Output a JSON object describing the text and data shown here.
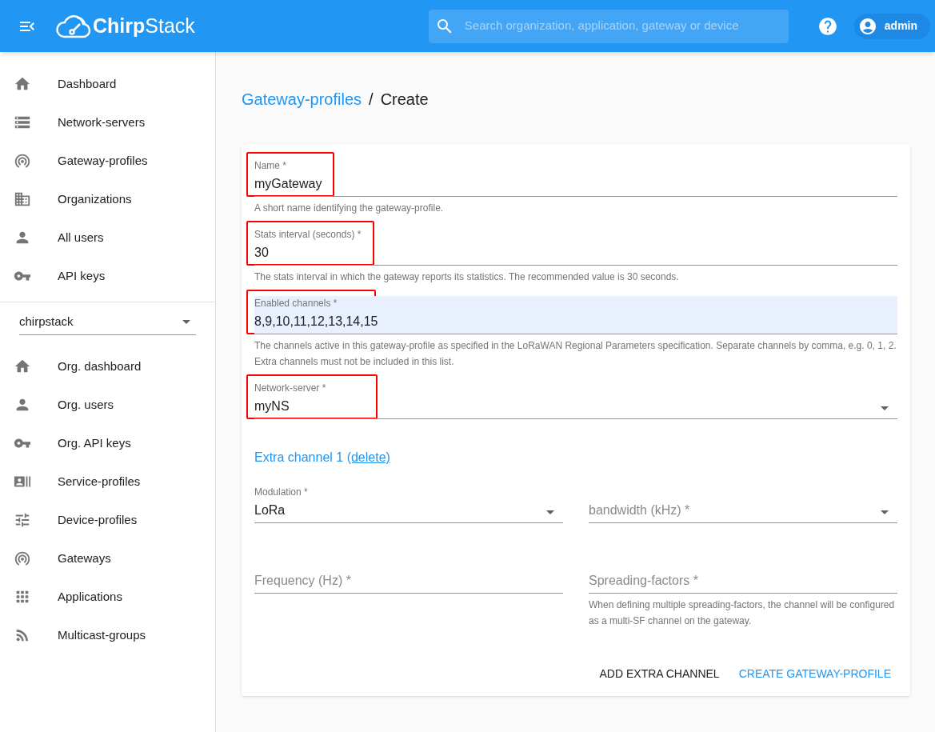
{
  "header": {
    "logo": "**Chirp**Stack",
    "search": {
      "placeholder": "Search organization, application, gateway or device"
    },
    "user": "admin"
  },
  "sidebar": {
    "admin_items": [
      {
        "label": "Dashboard"
      },
      {
        "label": "Network-servers"
      },
      {
        "label": "Gateway-profiles"
      },
      {
        "label": "Organizations"
      },
      {
        "label": "All users"
      },
      {
        "label": "API keys"
      }
    ],
    "organization_select": {
      "value": "chirpstack"
    },
    "org_items": [
      {
        "label": "Org. dashboard"
      },
      {
        "label": "Org. users"
      },
      {
        "label": "Org. API keys"
      },
      {
        "label": "Service-profiles"
      },
      {
        "label": "Device-profiles"
      },
      {
        "label": "Gateways"
      },
      {
        "label": "Applications"
      },
      {
        "label": "Multicast-groups"
      }
    ]
  },
  "breadcrumb": {
    "link": "Gateway-profiles",
    "separator": "/",
    "current": "Create"
  },
  "form": {
    "fields": [
      {
        "kind": "text",
        "label": "Name *",
        "value": "myGateway",
        "helper": "A short name identifying the gateway-profile.",
        "highlighted": true,
        "autofilled": false
      },
      {
        "kind": "text",
        "label": "Stats interval (seconds) *",
        "value": "30",
        "helper": "The stats interval in which the gateway reports its statistics. The recommended value is 30 seconds.",
        "highlighted": true,
        "autofilled": false
      },
      {
        "kind": "text",
        "label": "Enabled channels *",
        "value": "8,9,10,11,12,13,14,15",
        "helper": "The channels active in this gateway-profile as specified in the LoRaWAN Regional Parameters specification. Separate channels by comma, e.g. 0, 1, 2. Extra channels must not be included in this list.",
        "highlighted": true,
        "autofilled": true
      },
      {
        "kind": "select",
        "label": "Network-server *",
        "value": "myNS",
        "highlighted": true,
        "autofilled": false
      }
    ],
    "extra_channel": {
      "title": "Extra channel 1",
      "delete_link": "(delete)",
      "fields": [
        {
          "kind": "select",
          "label": "Modulation *",
          "value": "LoRa"
        },
        {
          "kind": "select",
          "placeholder": "bandwidth (kHz) *"
        },
        {
          "kind": "text",
          "placeholder": "Frequency (Hz) *"
        },
        {
          "kind": "text",
          "placeholder": "Spreading-factors *",
          "helper": "When defining multiple spreading-factors, the channel will be configured as a multi-SF channel on the gateway."
        }
      ]
    },
    "buttons": [
      {
        "label": "ADD EXTRA CHANNEL",
        "primary": false
      },
      {
        "label": "CREATE GATEWAY-PROFILE",
        "primary": true
      }
    ]
  }
}
